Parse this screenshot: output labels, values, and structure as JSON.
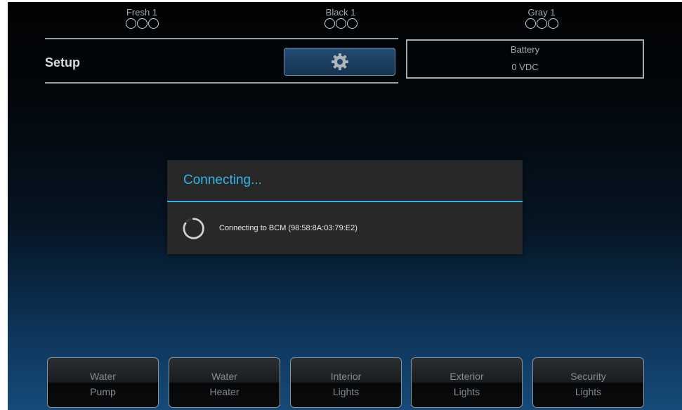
{
  "tanks": [
    {
      "label": "Fresh 1"
    },
    {
      "label": "Black 1"
    },
    {
      "label": "Gray 1"
    }
  ],
  "setup": {
    "label": "Setup",
    "button_icon": "gear-icon"
  },
  "battery": {
    "title": "Battery",
    "value": "0 VDC"
  },
  "dialog": {
    "title": "Connecting...",
    "message": "Connecting to BCM (98:58:8A:03:79:E2)",
    "accent_color": "#33b5e5"
  },
  "controls": [
    {
      "line1": "Water",
      "line2": "Pump"
    },
    {
      "line1": "Water",
      "line2": "Heater"
    },
    {
      "line1": "Interior",
      "line2": "Lights"
    },
    {
      "line1": "Exterior",
      "line2": "Lights"
    },
    {
      "line1": "Security",
      "line2": "Lights"
    }
  ]
}
